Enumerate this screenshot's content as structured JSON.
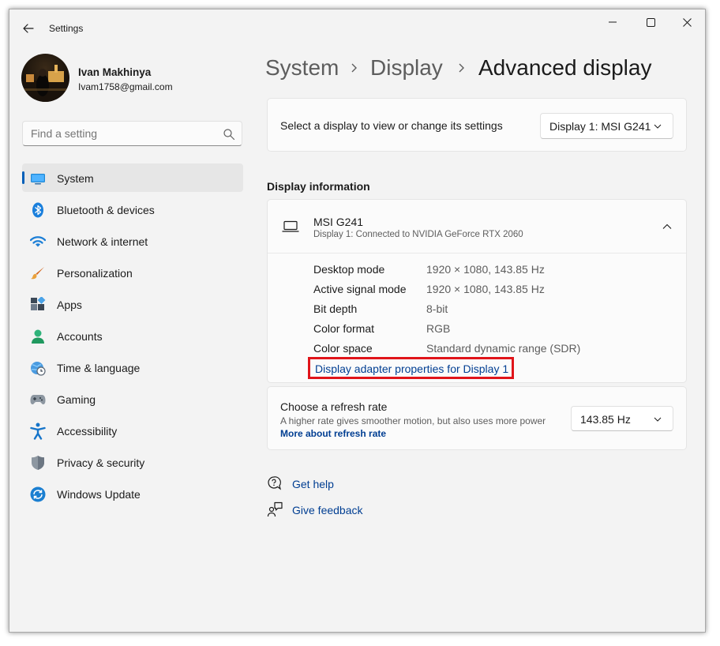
{
  "app": {
    "title": "Settings"
  },
  "window_controls": {
    "minimize": "minimize",
    "maximize": "maximize",
    "close": "close"
  },
  "profile": {
    "name": "Ivan Makhinya",
    "email": "Ivam1758@gmail.com"
  },
  "search": {
    "placeholder": "Find a setting",
    "value": ""
  },
  "nav": {
    "items": [
      {
        "label": "System",
        "icon": "system-icon",
        "active": true
      },
      {
        "label": "Bluetooth & devices",
        "icon": "bluetooth-icon"
      },
      {
        "label": "Network & internet",
        "icon": "wifi-icon"
      },
      {
        "label": "Personalization",
        "icon": "brush-icon"
      },
      {
        "label": "Apps",
        "icon": "apps-icon"
      },
      {
        "label": "Accounts",
        "icon": "account-icon"
      },
      {
        "label": "Time & language",
        "icon": "clock-globe-icon"
      },
      {
        "label": "Gaming",
        "icon": "gamepad-icon"
      },
      {
        "label": "Accessibility",
        "icon": "accessibility-icon"
      },
      {
        "label": "Privacy & security",
        "icon": "shield-icon"
      },
      {
        "label": "Windows Update",
        "icon": "update-icon"
      }
    ]
  },
  "breadcrumb": {
    "level1": "System",
    "level2": "Display",
    "current": "Advanced display"
  },
  "select_display": {
    "label": "Select a display to view or change its settings",
    "selected": "Display 1: MSI G241"
  },
  "display_info": {
    "heading": "Display information",
    "monitor_name": "MSI G241",
    "monitor_sub": "Display 1: Connected to NVIDIA GeForce RTX 2060",
    "rows": [
      {
        "key": "Desktop mode",
        "value": "1920 × 1080, 143.85 Hz"
      },
      {
        "key": "Active signal mode",
        "value": "1920 × 1080, 143.85 Hz"
      },
      {
        "key": "Bit depth",
        "value": "8-bit"
      },
      {
        "key": "Color format",
        "value": "RGB"
      },
      {
        "key": "Color space",
        "value": "Standard dynamic range (SDR)"
      }
    ],
    "adapter_link": "Display adapter properties for Display 1"
  },
  "refresh": {
    "title": "Choose a refresh rate",
    "description": "A higher rate gives smoother motion, but also uses more power",
    "link": "More about refresh rate",
    "selected": "143.85 Hz"
  },
  "help": {
    "get_help": "Get help",
    "give_feedback": "Give feedback"
  },
  "colors": {
    "accent": "#005fb8",
    "link": "#003e92",
    "highlight_border": "#e0141a"
  }
}
